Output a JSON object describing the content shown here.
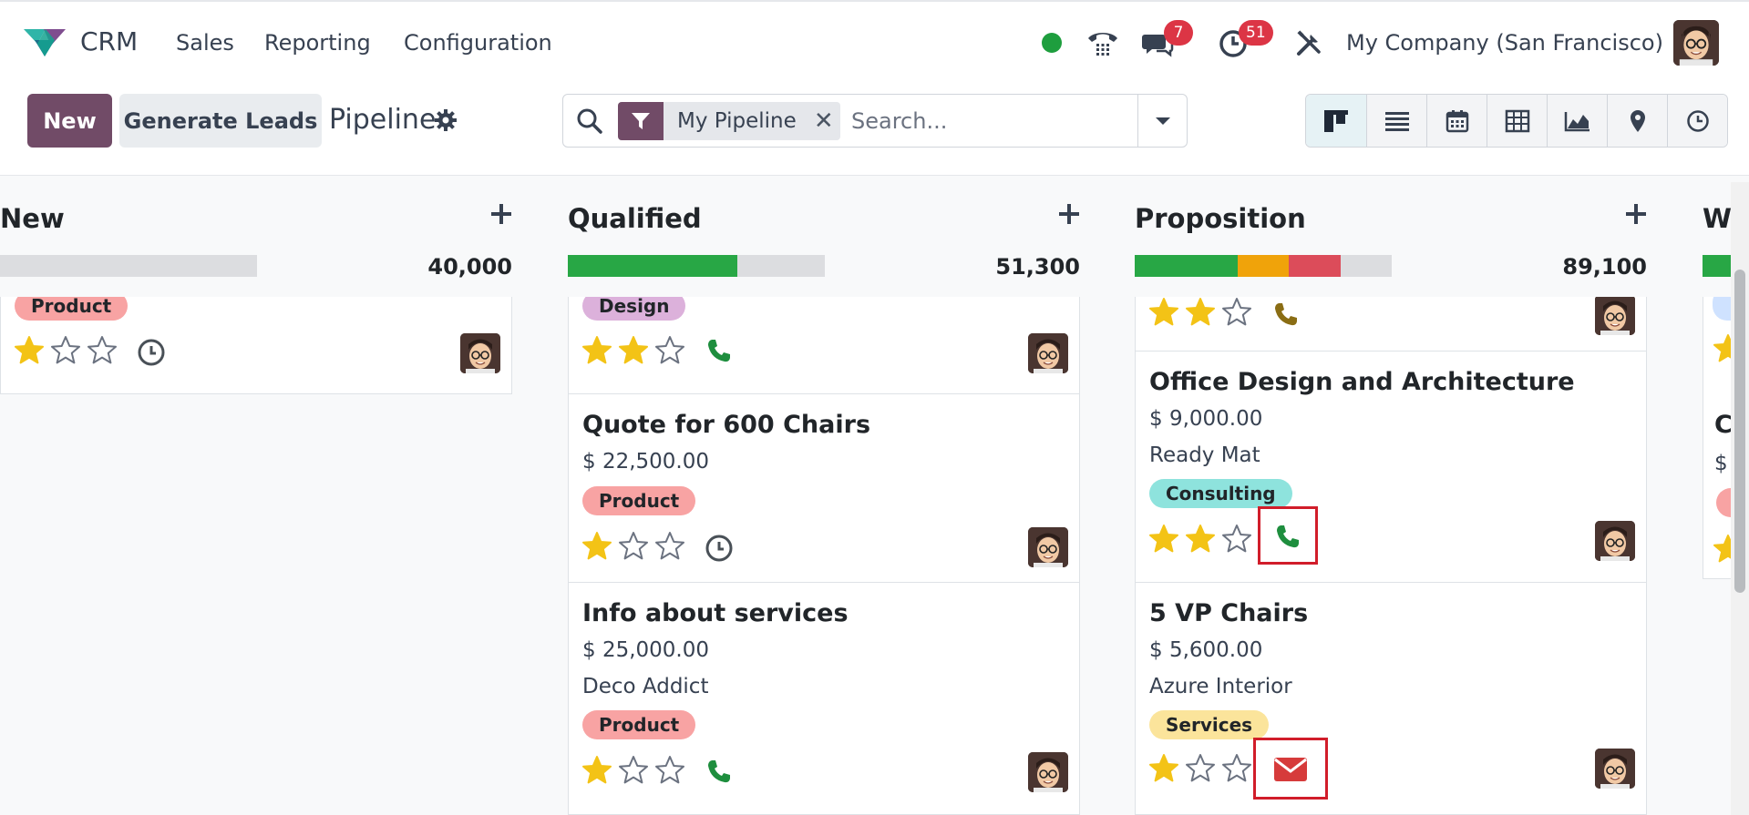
{
  "nav": {
    "app_name": "CRM",
    "menu": [
      "Sales",
      "Reporting",
      "Configuration"
    ],
    "messages_badge": "7",
    "activities_badge": "51",
    "company": "My Company (San Francisco)"
  },
  "control_panel": {
    "new_label": "New",
    "generate_label": "Generate Leads",
    "breadcrumb": "Pipeline",
    "search": {
      "facet": "My Pipeline",
      "placeholder": "Search..."
    },
    "views": [
      "kanban-icon",
      "list-icon",
      "calendar-icon",
      "pivot-icon",
      "graph-icon",
      "map-icon",
      "activity-icon"
    ],
    "active_view": "kanban-icon"
  },
  "columns": [
    {
      "title": "New",
      "total": "40,000",
      "progress": [],
      "cards": [
        {
          "tag": "Product",
          "tag_type": "product",
          "stars": 1,
          "activity": "clock-icon"
        }
      ]
    },
    {
      "title": "Qualified",
      "total": "51,300",
      "progress": [
        {
          "color": "#28a745",
          "fraction": 0.66
        }
      ],
      "cards": [
        {
          "tag": "Design",
          "tag_type": "design",
          "stars": 2,
          "activity": "phone-icon"
        },
        {
          "title": "Quote for 600 Chairs",
          "amount": "$ 22,500.00",
          "tag": "Product",
          "tag_type": "product",
          "stars": 1,
          "activity": "clock-icon"
        },
        {
          "title": "Info about services",
          "amount": "$ 25,000.00",
          "customer": "Deco Addict",
          "tag": "Product",
          "tag_type": "product",
          "stars": 1,
          "activity": "phone-icon"
        }
      ]
    },
    {
      "title": "Proposition",
      "total": "89,100",
      "progress": [
        {
          "color": "#28a745",
          "fraction": 0.4
        },
        {
          "color": "#f0a30a",
          "fraction": 0.2
        },
        {
          "color": "#dc4c5a",
          "fraction": 0.2
        }
      ],
      "cards": [
        {
          "stars": 2,
          "activity": "phone-icon"
        },
        {
          "title": "Office Design and Architecture",
          "amount": "$ 9,000.00",
          "customer": "Ready Mat",
          "tag": "Consulting",
          "tag_type": "consulting",
          "stars": 2,
          "activity": "phone-icon"
        },
        {
          "title": "5 VP Chairs",
          "amount": "$ 5,600.00",
          "customer": "Azure Interior",
          "tag": "Services",
          "tag_type": "services",
          "stars": 1,
          "activity": "envelope-icon"
        }
      ]
    },
    {
      "title": "We",
      "progress": [
        {
          "color": "#28a745",
          "fraction": 1
        }
      ],
      "cards": [
        {
          "title": "C",
          "amount": "$"
        }
      ]
    }
  ],
  "colors": {
    "brand": "#714b67",
    "star": "#f3c316",
    "phone_green": "#1e8e3e",
    "phone_overdue": "#8a6d14",
    "highlight": "#d11d2a"
  }
}
